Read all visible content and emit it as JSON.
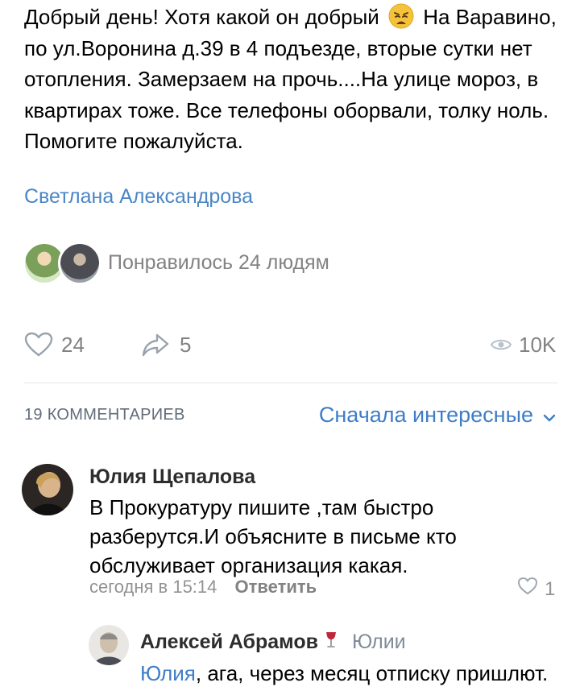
{
  "post": {
    "text_part1": "Добрый день! Хотя какой он добрый",
    "emoji_icon": "weary-face-emoji",
    "text_part2": " На Варавино, по ул.Воронина д.39 в 4 подъезде, вторые сутки нет отопления. Замерзаем на прочь....На улице мороз, в квартирах тоже. Все телефоны оборвали, толку ноль. Помогите пожалуйста.",
    "author": "Светлана Александрова",
    "likes_text": "Понравилось 24 людям"
  },
  "actions": {
    "likes": "24",
    "shares": "5",
    "views": "10K"
  },
  "comments_header": {
    "count_label": "19 КОММЕНТАРИЕВ",
    "sort_label": "Сначала интересные"
  },
  "comments": [
    {
      "name": "Юлия Щепалова",
      "text": "В Прокуратуру пишите ,там быстро разберутся.И объясните в письме кто обслуживает организация какая.",
      "time": "сегодня в 15:14",
      "reply_label": "Ответить",
      "likes": "1"
    },
    {
      "name": "Алексей Абрамов",
      "badge_icon": "wine-glass-icon",
      "to_user": "Юлии",
      "mention": "Юлия",
      "text": ", ага, через месяц отписку пришлют."
    }
  ],
  "colors": {
    "link": "#2a5885",
    "accent": "#3f7dc7",
    "muted": "#828282",
    "divider": "#e3e4e8"
  }
}
